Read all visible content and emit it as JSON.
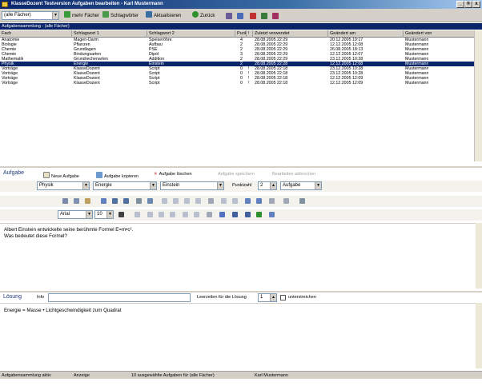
{
  "window": {
    "title": "KlasseDozent Testversion Aufgaben bearbeiten - Karl Mustermann",
    "buttons": [
      "_",
      "®",
      "x"
    ]
  },
  "toolbar": {
    "subject_filter": "(alle Fächer)",
    "more_subjects": "mehr Fächer",
    "keywords": "Schlagwörter",
    "refresh": "Aktualisieren",
    "back": "Zurück"
  },
  "list": {
    "header": "Aufgabensammlung - (alle Fächer)",
    "columns": [
      "Fach",
      "Schlagwort 1",
      "Schlagwort 2",
      "Punktzahl",
      "!",
      "Zuletzt verwendet",
      "Geändert am",
      "Geändert von"
    ],
    "rows": [
      {
        "fach": "Anatomie",
        "sw1": "Magen-Darm",
        "sw2": "Speiseröhre",
        "punkte": "4",
        "flag": "",
        "zuletzt": "28.08.2005 22:29",
        "geaendert": "20.12.2005 19:17",
        "von": "Mustermann"
      },
      {
        "fach": "Biologie",
        "sw1": "Pflanzen",
        "sw2": "Aufbau",
        "punkte": "2",
        "flag": "",
        "zuletzt": "28.08.2005 22:29",
        "geaendert": "12.12.2005 12:08",
        "von": "Mustermann"
      },
      {
        "fach": "Chemie",
        "sw1": "Grundlagen",
        "sw2": "PSE",
        "punkte": "2",
        "flag": "",
        "zuletzt": "28.08.2005 22:29",
        "geaendert": "26.08.2005 18:13",
        "von": "Mustermann"
      },
      {
        "fach": "Chemie",
        "sw1": "Bindungsarten",
        "sw2": "Dipol",
        "punkte": "3",
        "flag": "",
        "zuletzt": "28.08.2005 22:29",
        "geaendert": "12.12.2005 12:07",
        "von": "Mustermann"
      },
      {
        "fach": "Mathematik",
        "sw1": "Grundrechenarten",
        "sw2": "Addition",
        "punkte": "2",
        "flag": "",
        "zuletzt": "28.08.2005 22:29",
        "geaendert": "23.12.2005 10:28",
        "von": "Mustermann"
      },
      {
        "fach": "Physik",
        "sw1": "Energie",
        "sw2": "Einstein",
        "punkte": "2",
        "flag": "",
        "zuletzt": "28.08.2005 22:28",
        "geaendert": "12.12.2005 12:08",
        "von": "Mustermann"
      },
      {
        "fach": "Vorträge",
        "sw1": "KlasseDozent",
        "sw2": "Script",
        "punkte": "0",
        "flag": "!",
        "zuletzt": "28.08.2005 22:18",
        "geaendert": "23.12.2005 10:28",
        "von": "Mustermann"
      },
      {
        "fach": "Vorträge",
        "sw1": "KlasseDozent",
        "sw2": "Script",
        "punkte": "0",
        "flag": "!",
        "zuletzt": "28.08.2005 22:18",
        "geaendert": "23.12.2005 10:28",
        "von": "Mustermann"
      },
      {
        "fach": "Vorträge",
        "sw1": "KlasseDozent",
        "sw2": "Script",
        "punkte": "0",
        "flag": "!",
        "zuletzt": "28.08.2005 22:18",
        "geaendert": "12.12.2005 12:09",
        "von": "Mustermann"
      },
      {
        "fach": "Vorträge",
        "sw1": "KlasseDozent",
        "sw2": "Script",
        "punkte": "0",
        "flag": "!",
        "zuletzt": "28.08.2005 22:18",
        "geaendert": "12.12.2005 12:09",
        "von": "Mustermann"
      }
    ],
    "selected_index": 5,
    "colors": {
      "selection": "#0a246a",
      "header": "#0a246a"
    }
  },
  "aufgabe": {
    "title": "Aufgabe",
    "new_label": "Neue Aufgabe",
    "copy_label": "Aufgabe kopieren",
    "delete_label": "Aufgabe löschen",
    "save_label": "Aufgabe speichern",
    "cancel_label": "Bearbeiten abbrechen",
    "fach": "Physik",
    "sw1": "Energie",
    "sw2": "Einstein",
    "punkte_label": "Punktzahl",
    "punkte": "2",
    "typ": "Aufgabe",
    "font_name": "Arial",
    "font_size": "10",
    "text_line1": "Albert Einstein entwickelte seine berühmte Formel E=m•c².",
    "text_line2": "Was bedeutet diese Formel?"
  },
  "loesung": {
    "title": "Lösung",
    "info_label": "Info",
    "lines_label": "Leerzeilen für die Lösung",
    "lines_value": "1",
    "underline_label": "unterstreichen",
    "text": "Energie = Masse • Lichtgeschwindigkeit zum Quadrat"
  },
  "status": {
    "mode": "Aufgabensammlung aktiv",
    "view": "Anzeige",
    "count": "10 ausgewählte Aufgaben für (alle Fächer)",
    "user": "Karl Mustermann"
  }
}
